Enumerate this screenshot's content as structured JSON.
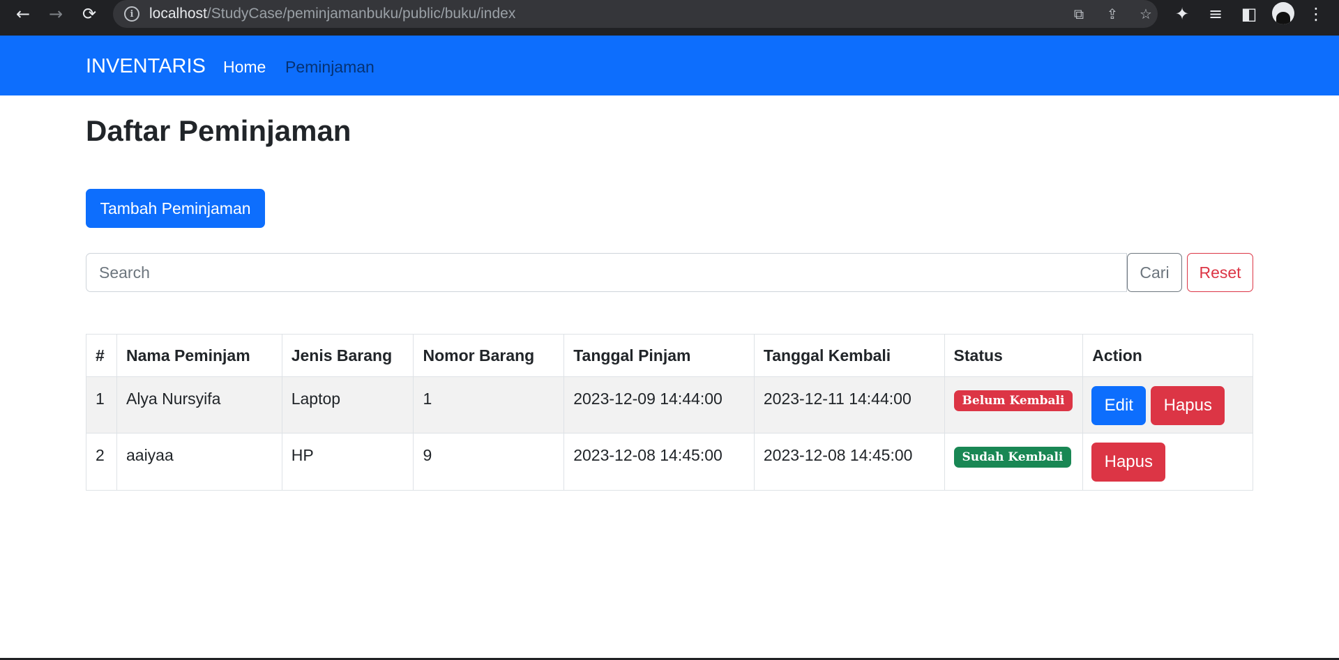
{
  "browser": {
    "url_host": "localhost",
    "url_path": "/StudyCase/peminjamanbuku/public/buku/index"
  },
  "navbar": {
    "brand": "INVENTARIS",
    "links": [
      "Home",
      "Peminjaman"
    ]
  },
  "page": {
    "title": "Daftar Peminjaman",
    "add_button": "Tambah Peminjaman",
    "search_placeholder": "Search",
    "search_button": "Cari",
    "reset_button": "Reset"
  },
  "table": {
    "headers": [
      "#",
      "Nama Peminjam",
      "Jenis Barang",
      "Nomor Barang",
      "Tanggal Pinjam",
      "Tanggal Kembali",
      "Status",
      "Action"
    ],
    "rows": [
      {
        "no": "1",
        "nama": "Alya Nursyifa",
        "jenis": "Laptop",
        "nomor": "1",
        "tanggal_pinjam": "2023-12-09 14:44:00",
        "tanggal_kembali": "2023-12-11 14:44:00",
        "status": "Belum Kembali",
        "status_color": "#dc3545",
        "actions": [
          "Edit",
          "Hapus"
        ]
      },
      {
        "no": "2",
        "nama": "aaiyaa",
        "jenis": "HP",
        "nomor": "9",
        "tanggal_pinjam": "2023-12-08 14:45:00",
        "tanggal_kembali": "2023-12-08 14:45:00",
        "status": "Sudah Kembali",
        "status_color": "#198754",
        "actions": [
          "Hapus"
        ]
      }
    ]
  },
  "colors": {
    "primary": "#0d6efd",
    "danger": "#dc3545",
    "success": "#198754",
    "secondary": "#6c757d"
  }
}
